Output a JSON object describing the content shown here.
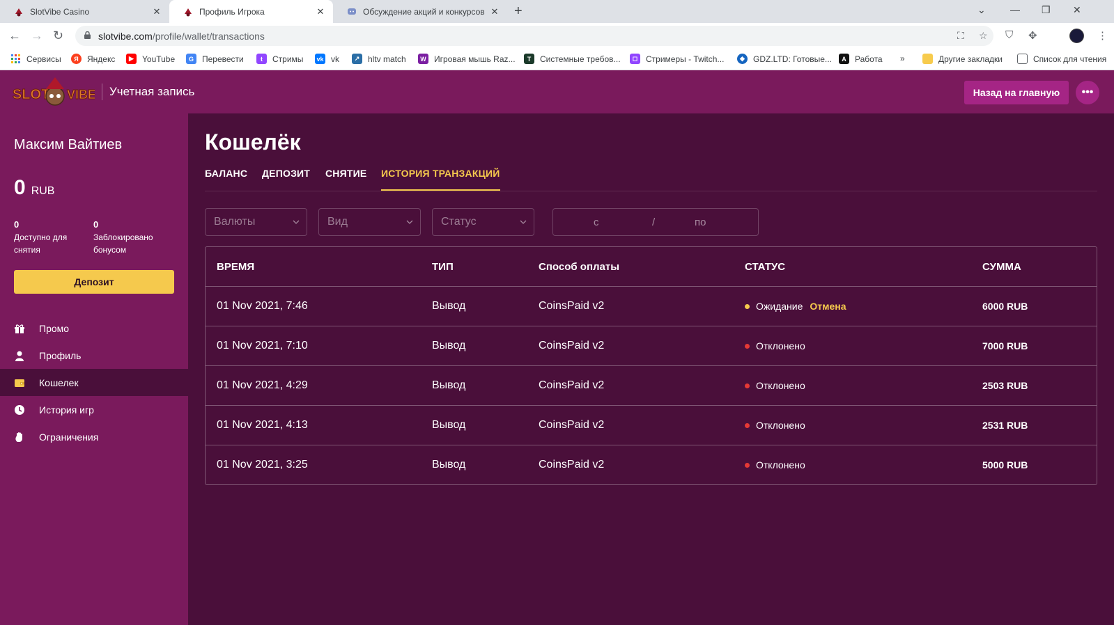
{
  "browser": {
    "tabs": [
      {
        "label": "SlotVibe Casino",
        "active": false
      },
      {
        "label": "Профиль Игрока",
        "active": true
      },
      {
        "label": "Обсуждение акций и конкурсов",
        "active": false
      }
    ],
    "url_host": "slotvibe.com",
    "url_path": "/profile/wallet/transactions",
    "bookmarks": [
      {
        "label": "Сервисы",
        "color": "#4285f4"
      },
      {
        "label": "Яндекс",
        "color": "#fc3f1d"
      },
      {
        "label": "YouTube",
        "color": "#ff0000"
      },
      {
        "label": "Перевести",
        "color": "#4285f4"
      },
      {
        "label": "Стримы",
        "color": "#9146ff"
      },
      {
        "label": "vk",
        "color": "#0077ff"
      },
      {
        "label": "hltv match",
        "color": "#2b6ea6"
      },
      {
        "label": "Игровая мышь Raz...",
        "color": "#7b1fa2"
      },
      {
        "label": "Системные требов...",
        "color": "#1b3a2a"
      },
      {
        "label": "Стримеры - Twitch...",
        "color": "#9146ff"
      },
      {
        "label": "GDZ.LTD: Готовые...",
        "color": "#1565c0"
      },
      {
        "label": "Работа",
        "color": "#111111"
      }
    ],
    "bookmarks_more": "»",
    "other_bookmarks": "Другие закладки",
    "reading_list": "Список для чтения"
  },
  "header": {
    "logo_text": "SLOTVIBE",
    "title": "Учетная запись",
    "home_button": "Назад на главную"
  },
  "sidebar": {
    "user_name": "Максим Вайтиев",
    "balance": "0",
    "currency": "RUB",
    "available_value": "0",
    "available_label": "Доступно для снятия",
    "blocked_value": "0",
    "blocked_label": "Заблокировано бонусом",
    "deposit_button": "Депозит",
    "menu": [
      {
        "label": "Промо",
        "icon": "gift-icon"
      },
      {
        "label": "Профиль",
        "icon": "user-icon"
      },
      {
        "label": "Кошелек",
        "icon": "wallet-icon",
        "active": true
      },
      {
        "label": "История игр",
        "icon": "clock-icon"
      },
      {
        "label": "Ограничения",
        "icon": "hand-icon"
      }
    ]
  },
  "main": {
    "title": "Кошелёк",
    "tabs": [
      "БАЛАНС",
      "ДЕПОЗИТ",
      "СНЯТИЕ",
      "ИСТОРИЯ ТРАНЗАКЦИЙ"
    ],
    "active_tab": 3,
    "filters": {
      "currency_placeholder": "Валюты",
      "type_placeholder": "Вид",
      "status_placeholder": "Статус",
      "date_from": "с",
      "date_sep": "/",
      "date_to": "по"
    },
    "table": {
      "headers": [
        "ВРЕМЯ",
        "ТИП",
        "Способ оплаты",
        "СТАТУС",
        "СУММА"
      ],
      "rows": [
        {
          "time": "01 Nov 2021, 7:46",
          "type": "Вывод",
          "method": "CoinsPaid v2",
          "status": "Ожидание",
          "status_color": "#f5c94d",
          "action": "Отмена",
          "amount": "6000 RUB"
        },
        {
          "time": "01 Nov 2021, 7:10",
          "type": "Вывод",
          "method": "CoinsPaid v2",
          "status": "Отклонено",
          "status_color": "#e53935",
          "action": "",
          "amount": "7000 RUB"
        },
        {
          "time": "01 Nov 2021, 4:29",
          "type": "Вывод",
          "method": "CoinsPaid v2",
          "status": "Отклонено",
          "status_color": "#e53935",
          "action": "",
          "amount": "2503 RUB"
        },
        {
          "time": "01 Nov 2021, 4:13",
          "type": "Вывод",
          "method": "CoinsPaid v2",
          "status": "Отклонено",
          "status_color": "#e53935",
          "action": "",
          "amount": "2531 RUB"
        },
        {
          "time": "01 Nov 2021, 3:25",
          "type": "Вывод",
          "method": "CoinsPaid v2",
          "status": "Отклонено",
          "status_color": "#e53935",
          "action": "",
          "amount": "5000 RUB"
        }
      ]
    }
  },
  "colors": {
    "brand_purple": "#7a1a5c",
    "content_bg": "#4a0f3a",
    "accent_yellow": "#f5c94d",
    "button_pink": "#a52585"
  }
}
